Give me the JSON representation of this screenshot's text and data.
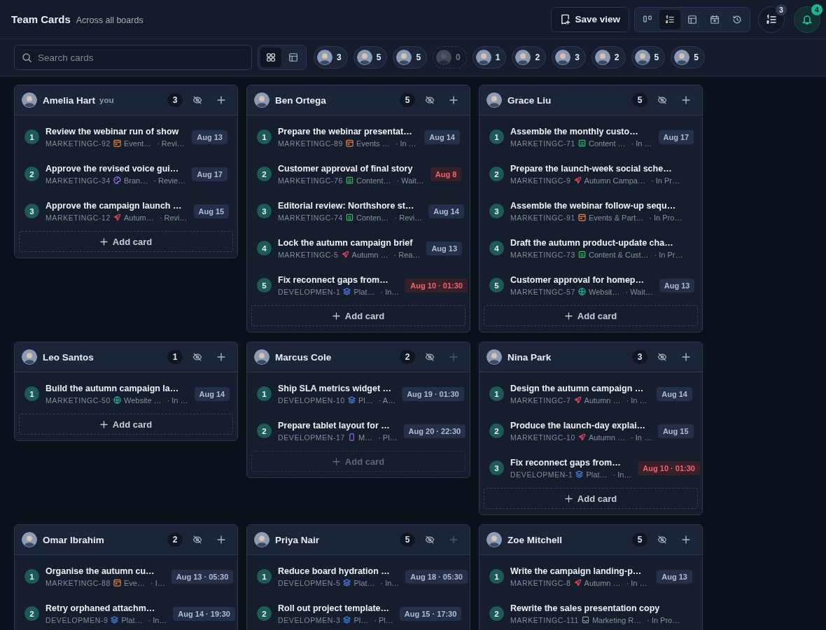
{
  "header": {
    "title": "Team Cards",
    "subtitle": "Across all boards",
    "save_label": "Save view",
    "views": [
      {
        "kind": "board",
        "selected": false
      },
      {
        "kind": "list",
        "selected": true
      },
      {
        "kind": "table",
        "selected": false
      },
      {
        "kind": "calendar",
        "selected": false
      },
      {
        "kind": "history",
        "selected": false
      }
    ],
    "tasks_badge": "3",
    "notifications_badge": "4"
  },
  "toolbar": {
    "search": {
      "placeholder": "Search cards"
    },
    "layouts": [
      {
        "kind": "grid",
        "selected": true
      },
      {
        "kind": "table",
        "selected": false
      }
    ],
    "people": [
      {
        "count": "3",
        "disabled": false
      },
      {
        "count": "5",
        "disabled": false
      },
      {
        "count": "5",
        "disabled": false
      },
      {
        "count": "0",
        "disabled": true
      },
      {
        "count": "1",
        "disabled": false
      },
      {
        "count": "2",
        "disabled": false
      },
      {
        "count": "3",
        "disabled": false
      },
      {
        "count": "2",
        "disabled": false
      },
      {
        "count": "5",
        "disabled": false
      },
      {
        "count": "5",
        "disabled": false
      }
    ]
  },
  "columns": [
    {
      "name": "Amelia Hart",
      "tag": "you",
      "count": "3",
      "can_add": true,
      "add_label": "Add card",
      "cards": [
        {
          "num": "1",
          "title": "Review the webinar run of show",
          "key": "MARKETINGC-92",
          "kind": "calendar",
          "project": "Event…",
          "status": "· Revi…",
          "date": "Aug 13",
          "overdue": false
        },
        {
          "num": "2",
          "title": "Approve the revised voice gui…",
          "key": "MARKETINGC-34",
          "kind": "palette",
          "project": "Bran…",
          "status": "· Revie…",
          "date": "Aug 17",
          "overdue": false
        },
        {
          "num": "3",
          "title": "Approve the campaign launch …",
          "key": "MARKETINGC-12",
          "kind": "rocket",
          "project": "Autum…",
          "status": "· Revi…",
          "date": "Aug 15",
          "overdue": false
        }
      ]
    },
    {
      "name": "Ben Ortega",
      "count": "5",
      "can_add": true,
      "add_label": "Add card",
      "cards": [
        {
          "num": "1",
          "title": "Prepare the webinar presentat…",
          "key": "MARKETINGC-89",
          "kind": "calendar",
          "project": "Events …",
          "status": "· In …",
          "date": "Aug 14",
          "overdue": false
        },
        {
          "num": "2",
          "title": "Customer approval of final story",
          "key": "MARKETINGC-76",
          "kind": "doc",
          "project": "Content…",
          "status": "· Wait…",
          "date": "Aug 8",
          "overdue": true
        },
        {
          "num": "3",
          "title": "Editorial review: Northshore st…",
          "key": "MARKETINGC-74",
          "kind": "doc",
          "project": "Conten…",
          "status": "· Revi…",
          "date": "Aug 14",
          "overdue": false
        },
        {
          "num": "4",
          "title": "Lock the autumn campaign brief",
          "key": "MARKETINGC-5",
          "kind": "rocket",
          "project": "Autumn …",
          "status": "· Rea…",
          "date": "Aug 13",
          "overdue": false
        },
        {
          "num": "5",
          "title": "Fix reconnect gaps from…",
          "key": "DEVELOPMEN-1",
          "kind": "layers",
          "project": "Plat…",
          "status": "· In…",
          "date": "Aug 10 · 01:30",
          "overdue": true
        }
      ]
    },
    {
      "name": "Grace Liu",
      "count": "5",
      "can_add": true,
      "add_label": "Add card",
      "cards": [
        {
          "num": "1",
          "title": "Assemble the monthly custo…",
          "key": "MARKETINGC-71",
          "kind": "doc",
          "project": "Content …",
          "status": "· In …",
          "date": "Aug 17",
          "overdue": false
        },
        {
          "num": "2",
          "title": "Prepare the launch-week social sche…",
          "key": "MARKETINGC-9",
          "kind": "rocket",
          "project": "Autumn Campa…",
          "status": "· In Pr…"
        },
        {
          "num": "3",
          "title": "Assemble the webinar follow-up sequ…",
          "key": "MARKETINGC-91",
          "kind": "calendar",
          "project": "Events & Part…",
          "status": "· In Pro…"
        },
        {
          "num": "4",
          "title": "Draft the autumn product-update cha…",
          "key": "MARKETINGC-73",
          "kind": "doc",
          "project": "Content & Cust…",
          "status": "· In Pr…"
        },
        {
          "num": "5",
          "title": "Customer approval for homep…",
          "key": "MARKETINGC-57",
          "kind": "globe",
          "project": "Websit…",
          "status": "· Wait…",
          "date": "Aug 13",
          "overdue": false
        }
      ]
    },
    {
      "name": "Leo Santos",
      "count": "1",
      "can_add": true,
      "add_label": "Add card",
      "cards": [
        {
          "num": "1",
          "title": "Build the autumn campaign la…",
          "key": "MARKETINGC-50",
          "kind": "globe",
          "project": "Website …",
          "status": "· In …",
          "date": "Aug 14",
          "overdue": false
        }
      ]
    },
    {
      "name": "Marcus Cole",
      "count": "2",
      "can_add": false,
      "add_label": "Add card",
      "cards": [
        {
          "num": "1",
          "title": "Ship SLA metrics widget …",
          "key": "DEVELOPMEN-10",
          "kind": "layers",
          "project": "Pl…",
          "status": "· A…",
          "date": "Aug 19 · 01:30",
          "overdue": false
        },
        {
          "num": "2",
          "title": "Prepare tablet layout for …",
          "key": "DEVELOPMEN-17",
          "kind": "phone",
          "project": "M…",
          "status": "· Pl…",
          "date": "Aug 20 · 22:30",
          "overdue": false
        }
      ]
    },
    {
      "name": "Nina Park",
      "count": "3",
      "can_add": true,
      "add_label": "Add card",
      "cards": [
        {
          "num": "1",
          "title": "Design the autumn campaign …",
          "key": "MARKETINGC-7",
          "kind": "rocket",
          "project": "Autumn …",
          "status": "· In …",
          "date": "Aug 14",
          "overdue": false
        },
        {
          "num": "2",
          "title": "Produce the launch-day explai…",
          "key": "MARKETINGC-10",
          "kind": "rocket",
          "project": "Autumn …",
          "status": "· In …",
          "date": "Aug 15",
          "overdue": false
        },
        {
          "num": "3",
          "title": "Fix reconnect gaps from…",
          "key": "DEVELOPMEN-1",
          "kind": "layers",
          "project": "Plat…",
          "status": "· In…",
          "date": "Aug 10 · 01:30",
          "overdue": true
        }
      ]
    },
    {
      "name": "Omar Ibrahim",
      "count": "2",
      "can_add": true,
      "cards": [
        {
          "num": "1",
          "title": "Organise the autumn cu…",
          "key": "MARKETINGC-88",
          "kind": "calendar",
          "project": "Eve…",
          "status": "· I…",
          "date": "Aug 13 · 05:30",
          "overdue": false
        },
        {
          "num": "2",
          "title": "Retry orphaned attachm…",
          "key": "DEVELOPMEN-9",
          "kind": "layers",
          "project": "Plat…",
          "status": "· In…",
          "date": "Aug 14 · 19:30",
          "overdue": false
        }
      ]
    },
    {
      "name": "Priya Nair",
      "count": "5",
      "can_add": false,
      "cards": [
        {
          "num": "1",
          "title": "Reduce board hydration …",
          "key": "DEVELOPMEN-5",
          "kind": "layers",
          "project": "Plat…",
          "status": "· In…",
          "date": "Aug 18 · 05:30",
          "overdue": false
        },
        {
          "num": "2",
          "title": "Roll out project template…",
          "key": "DEVELOPMEN-3",
          "kind": "layers",
          "project": "Pl…",
          "status": "· Pl…",
          "date": "Aug 15 · 17:30",
          "overdue": false
        }
      ]
    },
    {
      "name": "Zoe Mitchell",
      "count": "5",
      "can_add": true,
      "cards": [
        {
          "num": "1",
          "title": "Write the campaign landing-p…",
          "key": "MARKETINGC-8",
          "kind": "rocket",
          "project": "Autumn …",
          "status": "· In …",
          "date": "Aug 13",
          "overdue": false
        },
        {
          "num": "2",
          "title": "Rewrite the sales presentation copy",
          "key": "MARKETINGC-111",
          "kind": "inbox",
          "project": "Marketing R…",
          "status": "· In Pro…"
        }
      ]
    }
  ]
}
